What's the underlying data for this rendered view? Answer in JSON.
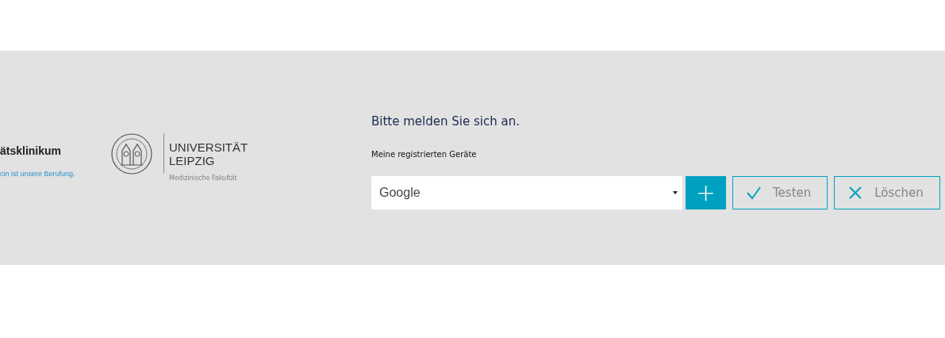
{
  "logos": {
    "clinic_name": "ätsklinikum",
    "clinic_tagline": "cin ist unsere Berufung.",
    "university_lines": [
      "UNIVERSITÄT",
      "LEIPZIG"
    ],
    "faculty": "Medizinische Fakultät"
  },
  "login": {
    "title": "Bitte melden Sie sich an.",
    "device_label": "Meine registrierten Geräte",
    "device_select": {
      "value": "Google"
    },
    "buttons": [
      {
        "kind": "add",
        "label": "+"
      },
      {
        "kind": "test",
        "label": "Testen"
      },
      {
        "kind": "delete",
        "label": "Löschen"
      }
    ]
  }
}
